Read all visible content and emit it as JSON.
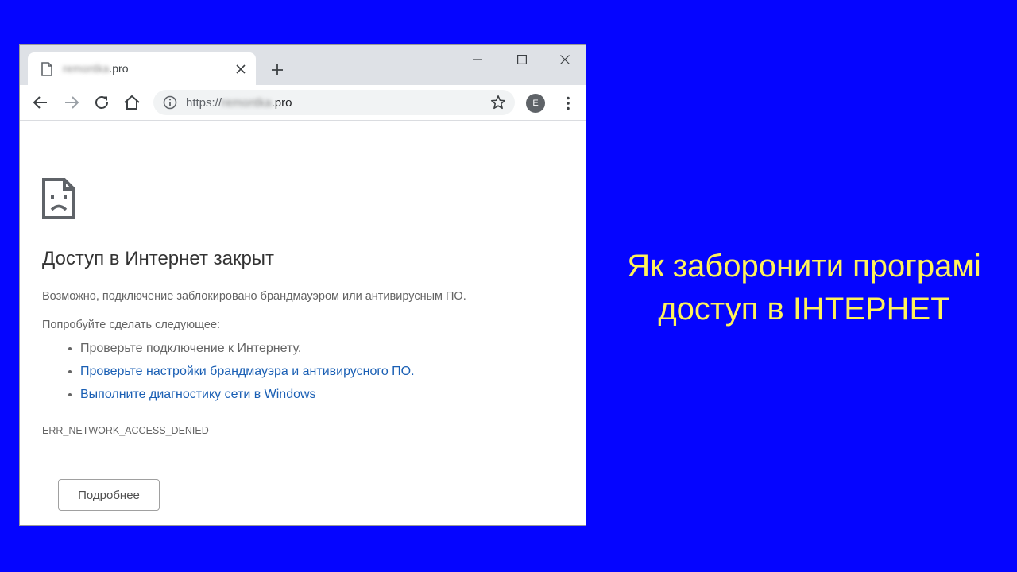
{
  "browser": {
    "tab": {
      "title_blurred": "remontka",
      "title_suffix": ".pro"
    },
    "address": {
      "scheme": "https://",
      "host_blurred": "remontka",
      "host_suffix": ".pro"
    },
    "profile_initial": "E"
  },
  "error_page": {
    "heading": "Доступ в Интернет закрыт",
    "description": "Возможно, подключение заблокировано брандмауэром или антивирусным ПО.",
    "try_label": "Попробуйте сделать следующее:",
    "suggestions": [
      "Проверьте подключение к Интернету.",
      "Проверьте настройки брандмауэра и антивирусного ПО.",
      "Выполните диагностику сети в Windows"
    ],
    "error_code": "ERR_NETWORK_ACCESS_DENIED",
    "details_button": "Подробнее"
  },
  "caption": {
    "line1": "Як заборонити програмі",
    "line2": "доступ в ІНТЕРНЕТ"
  },
  "colors": {
    "background": "#0505ff",
    "caption": "#fff25a",
    "link": "#1a5fb4"
  },
  "icons": {
    "tab_icon": "page-icon",
    "tab_close": "close-icon",
    "new_tab": "plus-icon",
    "minimize": "minimize-icon",
    "maximize": "maximize-icon",
    "close_window": "close-icon",
    "back": "arrow-left-icon",
    "forward": "arrow-right-icon",
    "reload": "reload-icon",
    "home": "home-icon",
    "site_info": "info-icon",
    "bookmark": "star-icon",
    "menu": "kebab-menu-icon",
    "error": "sad-page-icon"
  }
}
